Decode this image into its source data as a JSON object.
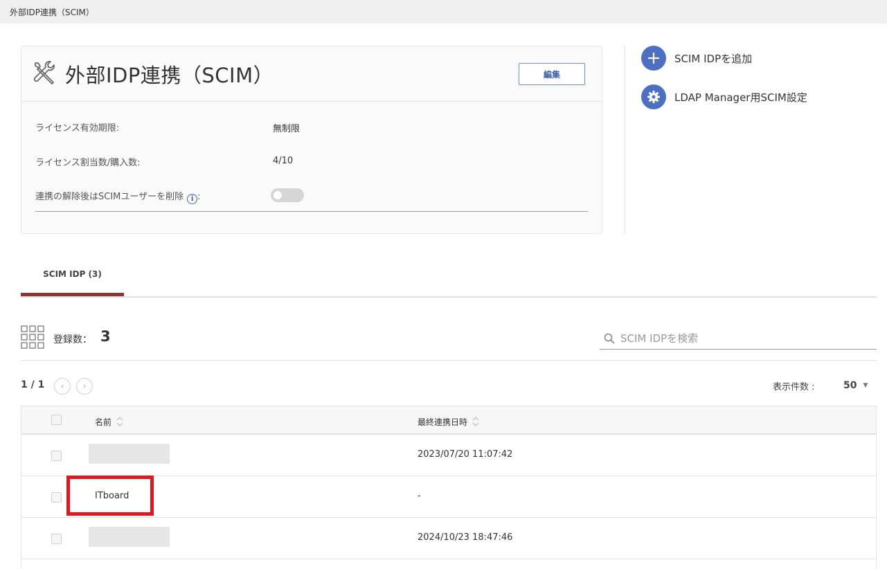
{
  "breadcrumb": "外部IDP連携（SCIM）",
  "card": {
    "title": "外部IDP連携（SCIM）",
    "edit_label": "編集",
    "rows": [
      {
        "label": "ライセンス有効期限:",
        "value": "無制限"
      },
      {
        "label": "ライセンス割当数/購入数:",
        "value": "4/10"
      }
    ],
    "delete_label": "連携の解除後はSCIMユーザーを削除",
    "delete_colon": ":",
    "delete_toggle_on": false
  },
  "actions": [
    {
      "label": "SCIM IDPを追加",
      "icon": "plus-icon"
    },
    {
      "label": "LDAP Manager用SCIM設定",
      "icon": "gear-icon"
    }
  ],
  "tab": {
    "label": "SCIM IDP (3)"
  },
  "summary": {
    "count_label": "登録数：",
    "count_value": "3"
  },
  "search": {
    "placeholder": "SCIM IDPを検索",
    "value": ""
  },
  "pagination": {
    "page": "1 / 1",
    "per_page_label": "表示件数 :",
    "per_page_value": "50"
  },
  "table": {
    "headers": {
      "name": "名前",
      "last_sync": "最終連携日時"
    },
    "rows": [
      {
        "name": "",
        "name_redacted": true,
        "last_sync": "2023/07/20 11:07:42"
      },
      {
        "name": "ITboard",
        "name_redacted": false,
        "last_sync": "-",
        "highlighted": true
      },
      {
        "name": "",
        "name_redacted": true,
        "last_sync": "2024/10/23 18:47:46"
      }
    ]
  },
  "colors": {
    "accent": "#4d6fc1",
    "tab_underline": "#8b3535",
    "highlight": "#e3161f",
    "button_border": "#6c8dc7"
  }
}
